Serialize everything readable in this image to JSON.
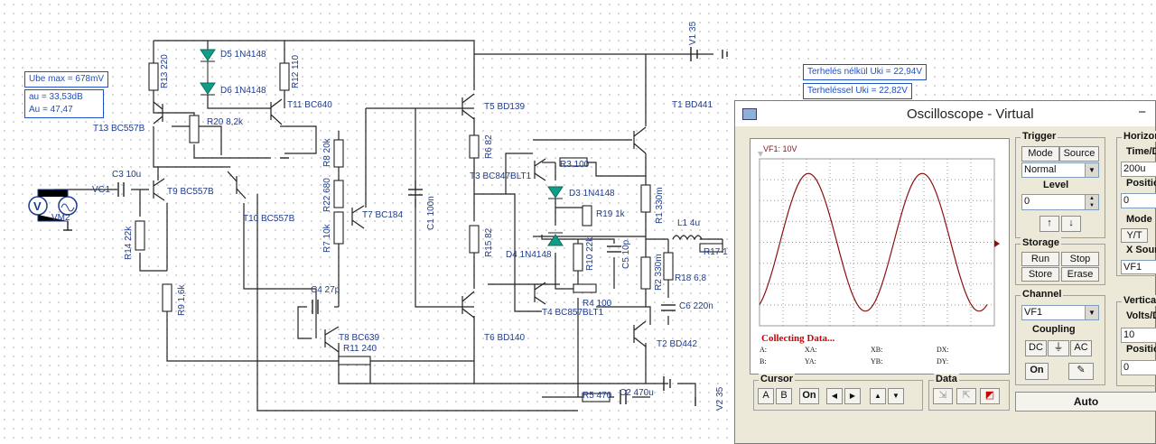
{
  "info_boxes": {
    "ube_max": "Ube max = 678mV",
    "au_db": "au = 33,53dB",
    "au_val": "Au = 47,47",
    "terheles_nelkul": "Terhelés nélkül Uki = 22,94V",
    "terhelessel": "Terheléssel Uki = 22,82V"
  },
  "components": {
    "r13": "R13 220",
    "d5": "D5 1N4148",
    "d6": "D6 1N4148",
    "r12": "R12 110",
    "r20": "R20 8,2k",
    "t11": "T11 BC640",
    "t13": "T13 BC557B",
    "c3": "C3 10u",
    "vg1": "VG1",
    "vm2": "VM2",
    "t9": "T9 BC557B",
    "t10": "T10 BC557B",
    "r14": "R14 22k",
    "r9": "R9 1,6k",
    "r8": "R8 20k",
    "r22": "R22 680",
    "r7": "R7 10k",
    "t7": "T7 BC184",
    "c1": "C1 100n",
    "c4": "C4 27p",
    "t8": "T8 BC639",
    "r11": "R11 240",
    "t5": "T5 BD139",
    "r6": "R6 82",
    "t3": "T3 BC847BLT1",
    "r3": "R3 100",
    "d3": "D3 1N4148",
    "r19": "R19 1k",
    "r15": "R15 82",
    "d4": "D4 1N4148",
    "r10": "R10 22k",
    "c5": "C5 10p",
    "t4": "T4 BC857BLT1",
    "r4": "R4 100",
    "t6": "T6 BD140",
    "t1": "T1 BD441",
    "r1": "R1 330m",
    "l1": "L1 4u",
    "r17": "R17 1",
    "r2": "R2 330m",
    "r18": "R18 6,8",
    "c6": "C6 220n",
    "t2": "T2 BD442",
    "r5": "R5 470",
    "c2": "C2 470u",
    "v1": "V1 35",
    "v2": "V2 35"
  },
  "oscilloscope": {
    "title": "Oscilloscope - Virtual",
    "channel_label": "VF1: 10V",
    "status": "Collecting Data...",
    "readouts": [
      "A:",
      "XA:",
      "XB:",
      "DX:",
      "B:",
      "YA:",
      "YB:",
      "DY:"
    ],
    "trigger": {
      "title": "Trigger",
      "mode_tab": "Mode",
      "source_tab": "Source",
      "mode_value": "Normal",
      "level_label": "Level",
      "level_value": "0"
    },
    "storage": {
      "title": "Storage",
      "run": "Run",
      "stop": "Stop",
      "store": "Store",
      "erase": "Erase"
    },
    "channel": {
      "title": "Channel",
      "value": "VF1",
      "coupling_label": "Coupling",
      "dc": "DC",
      "gnd": "⏚",
      "ac": "AC",
      "on": "On"
    },
    "horizontal": {
      "title": "Horizon",
      "time_label": "Time/D",
      "time_value": "200u",
      "position_label": "Position",
      "position_value": "0",
      "mode_label": "Mode",
      "yt": "Y/T",
      "xsource_label": "X Sour",
      "xsource_value": "VF1"
    },
    "vertical": {
      "title": "Vertical",
      "volts_label": "Volts/Di",
      "volts_value": "10",
      "position_label": "Position",
      "position_value": "0"
    },
    "cursor": {
      "title": "Cursor",
      "a": "A",
      "b": "B",
      "on": "On",
      "left": "◀",
      "right": "▶",
      "up": "▲",
      "down": "▼"
    },
    "data": {
      "title": "Data"
    },
    "auto": "Auto",
    "wave_color": "#8b1010"
  }
}
